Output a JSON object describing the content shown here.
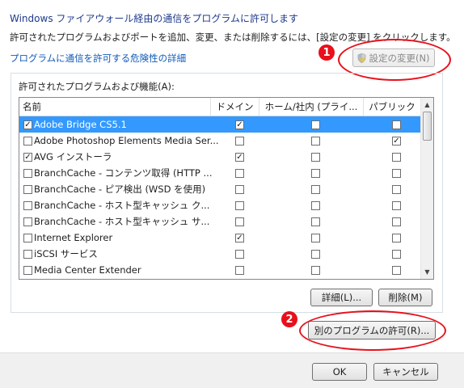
{
  "heading": "Windows ファイアウォール経由の通信をプログラムに許可します",
  "description": "許可されたプログラムおよびポートを追加、変更、または削除するには、[設定の変更] をクリックします。",
  "risk_link": "プログラムに通信を許可する危険性の詳細",
  "change_settings_label": "設定の変更(N)",
  "group_label": "許可されたプログラムおよび機能(A):",
  "columns": [
    "名前",
    "ドメイン",
    "ホーム/社内 (プライ...",
    "パブリック"
  ],
  "rows": [
    {
      "name": "Adobe Bridge CS5.1",
      "enabled": "✓",
      "domain": "✓",
      "home": "",
      "public": ""
    },
    {
      "name": "Adobe Photoshop Elements Media Ser...",
      "enabled": "",
      "domain": "",
      "home": "",
      "public": "✓"
    },
    {
      "name": "AVG インストーラ",
      "enabled": "✓",
      "domain": "✓",
      "home": "",
      "public": ""
    },
    {
      "name": "BranchCache - コンテンツ取得 (HTTP ...",
      "enabled": "",
      "domain": "",
      "home": "",
      "public": ""
    },
    {
      "name": "BranchCache - ピア検出 (WSD を使用)",
      "enabled": "",
      "domain": "",
      "home": "",
      "public": ""
    },
    {
      "name": "BranchCache - ホスト型キャッシュ ク...",
      "enabled": "",
      "domain": "",
      "home": "",
      "public": ""
    },
    {
      "name": "BranchCache - ホスト型キャッシュ サ...",
      "enabled": "",
      "domain": "",
      "home": "",
      "public": ""
    },
    {
      "name": "Internet Explorer",
      "enabled": "",
      "domain": "✓",
      "home": "",
      "public": ""
    },
    {
      "name": "iSCSI サービス",
      "enabled": "",
      "domain": "",
      "home": "",
      "public": ""
    },
    {
      "name": "Media Center Extender",
      "enabled": "",
      "domain": "",
      "home": "",
      "public": ""
    }
  ],
  "selected_row_index": 0,
  "details_label": "詳細(L)...",
  "remove_label": "削除(M)",
  "allow_another_label": "別のプログラムの許可(R)...",
  "ok_label": "OK",
  "cancel_label": "キャンセル",
  "callout_1": "1",
  "callout_2": "2",
  "colors": {
    "callout": "#e8101b",
    "selection": "#3399ff",
    "heading": "#1e3a8c",
    "link": "#0f5ab8"
  },
  "icons": [
    "uac-shield-icon",
    "scroll-up-icon",
    "scroll-down-icon"
  ]
}
